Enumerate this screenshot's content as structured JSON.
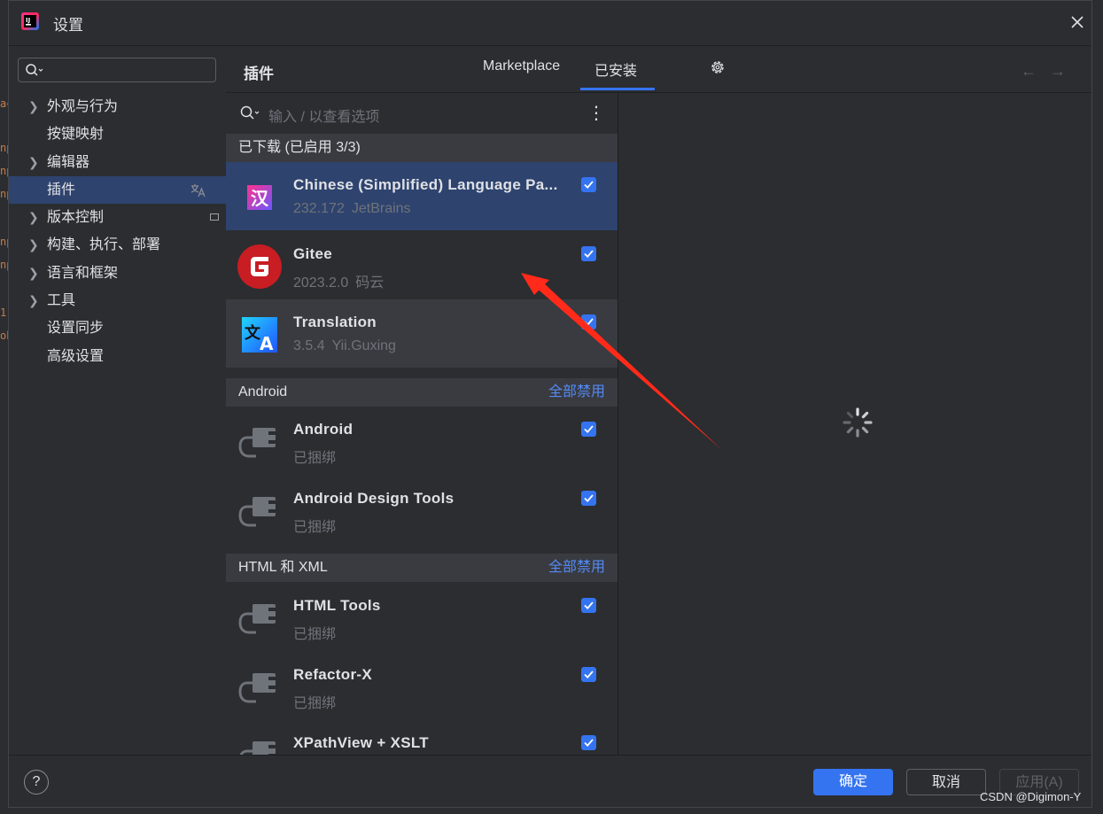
{
  "window": {
    "title": "设置",
    "close_icon": "close-icon"
  },
  "nav": {
    "search_placeholder": "",
    "items": [
      {
        "label": "外观与行为",
        "expandable": true
      },
      {
        "label": "按键映射",
        "expandable": false
      },
      {
        "label": "编辑器",
        "expandable": true
      },
      {
        "label": "插件",
        "expandable": false,
        "selected": true
      },
      {
        "label": "版本控制",
        "expandable": true
      },
      {
        "label": "构建、执行、部署",
        "expandable": true
      },
      {
        "label": "语言和框架",
        "expandable": true
      },
      {
        "label": "工具",
        "expandable": true
      },
      {
        "label": "设置同步",
        "expandable": false
      },
      {
        "label": "高级设置",
        "expandable": false
      }
    ]
  },
  "header": {
    "title": "插件",
    "tabs": [
      {
        "label": "Marketplace",
        "active": false
      },
      {
        "label": "已安装",
        "active": true
      }
    ]
  },
  "list": {
    "search_placeholder": "输入 / 以查看选项",
    "groups": [
      {
        "name": "已下载 (已启用 3/3)",
        "action": "",
        "plugins": [
          {
            "name": "Chinese (Simplified) Language Pa...",
            "version": "232.172",
            "vendor": "JetBrains",
            "checked": true,
            "icon": "chinese-language-icon"
          },
          {
            "name": "Gitee",
            "version": "2023.2.0",
            "vendor": "码云",
            "checked": true,
            "icon": "gitee-icon"
          },
          {
            "name": "Translation",
            "version": "3.5.4",
            "vendor": "Yii.Guxing",
            "checked": true,
            "icon": "translation-icon"
          }
        ]
      },
      {
        "name": "Android",
        "action": "全部禁用",
        "plugins": [
          {
            "name": "Android",
            "version": "",
            "vendor": "已捆绑",
            "checked": true,
            "icon": "plug-icon"
          },
          {
            "name": "Android Design Tools",
            "version": "",
            "vendor": "已捆绑",
            "checked": true,
            "icon": "plug-icon"
          }
        ]
      },
      {
        "name": "HTML 和 XML",
        "action": "全部禁用",
        "plugins": [
          {
            "name": "HTML Tools",
            "version": "",
            "vendor": "已捆绑",
            "checked": true,
            "icon": "plug-icon"
          },
          {
            "name": "Refactor-X",
            "version": "",
            "vendor": "已捆绑",
            "checked": true,
            "icon": "plug-icon"
          },
          {
            "name": "XPathView + XSLT",
            "version": "",
            "vendor": "",
            "checked": true,
            "icon": "plug-icon"
          }
        ]
      }
    ]
  },
  "footer": {
    "help": "?",
    "ok": "确定",
    "cancel": "取消",
    "apply": "应用(A)"
  },
  "watermark": "CSDN @Digimon-Y",
  "colors": {
    "accent": "#3574f0",
    "selection": "#2e436e",
    "link": "#548af7",
    "annotation": "#ff2a1a"
  }
}
